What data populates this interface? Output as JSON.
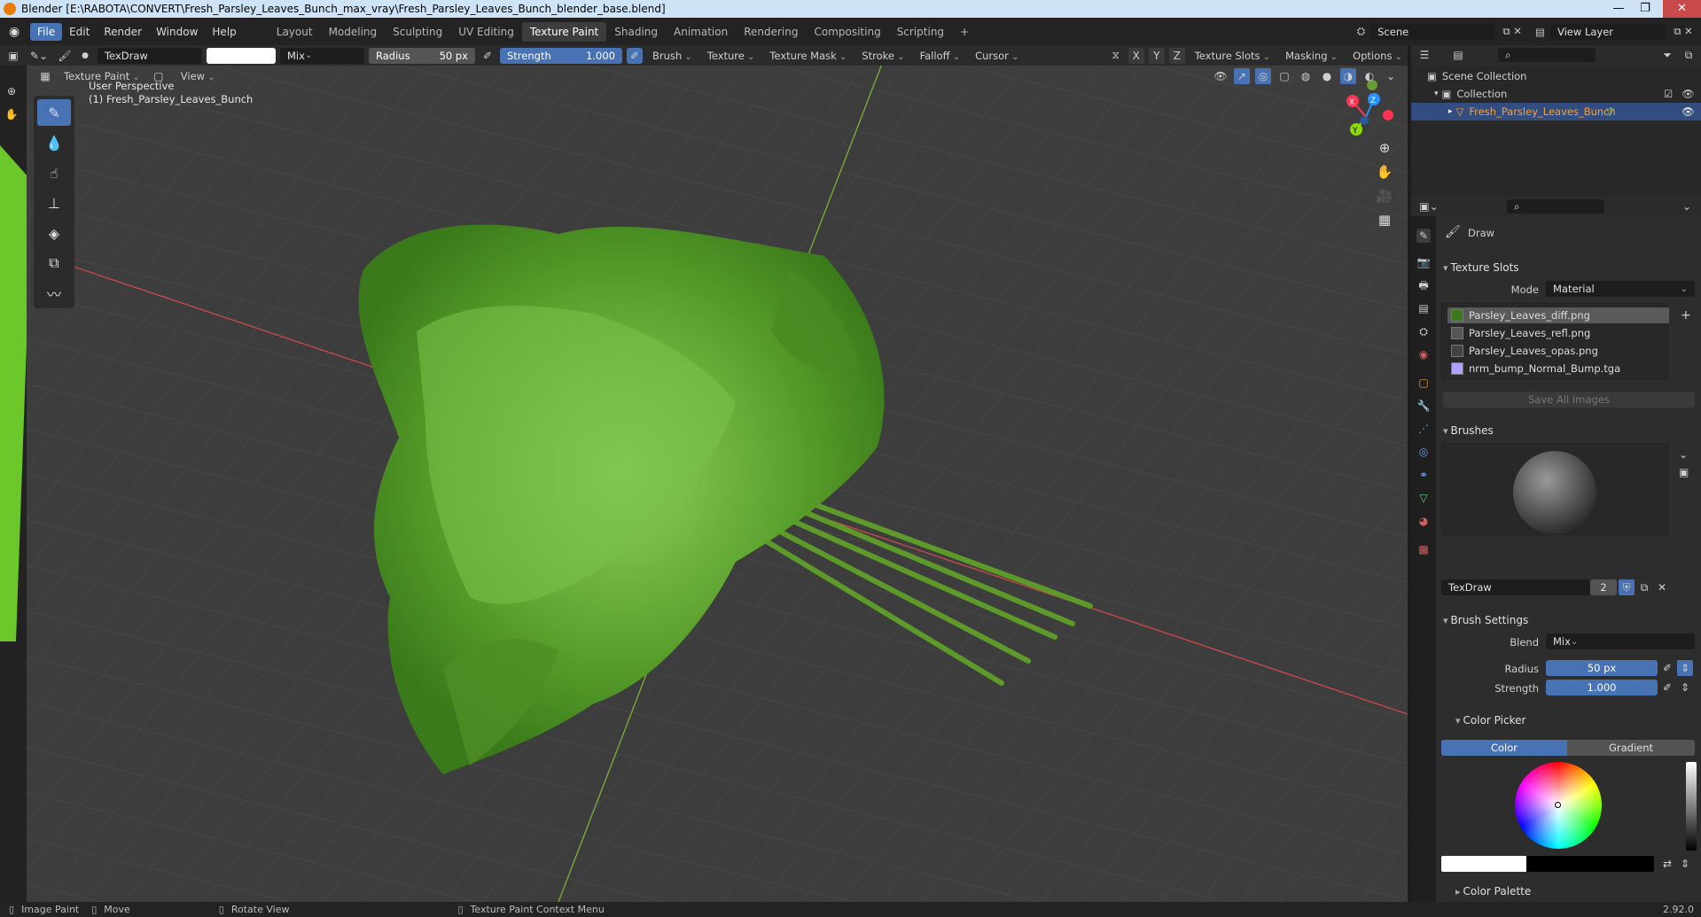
{
  "window": {
    "title": "Blender [E:\\RABOTA\\CONVERT\\Fresh_Parsley_Leaves_Bunch_max_vray\\Fresh_Parsley_Leaves_Bunch_blender_base.blend]",
    "minimize": "—",
    "maximize": "❐",
    "close": "✕"
  },
  "menus": [
    "File",
    "Edit",
    "Render",
    "Window",
    "Help"
  ],
  "workspaces": [
    "Layout",
    "Modeling",
    "Sculpting",
    "UV Editing",
    "Texture Paint",
    "Shading",
    "Animation",
    "Rendering",
    "Compositing",
    "Scripting"
  ],
  "workspace_add": "+",
  "scene": {
    "name": "Scene",
    "view_layer": "View Layer"
  },
  "tool_header": {
    "brush_name": "TexDraw",
    "blend": "Mix",
    "radius_label": "Radius",
    "radius_value": "50 px",
    "strength_label": "Strength",
    "strength_value": "1.000",
    "menus": [
      "Brush",
      "Texture",
      "Texture Mask",
      "Stroke",
      "Falloff",
      "Cursor"
    ],
    "axes": [
      "X",
      "Y",
      "Z"
    ],
    "right_menus": [
      "Texture Slots",
      "Masking",
      "Options"
    ]
  },
  "mode_header": {
    "mode": "Texture Paint",
    "view": "View"
  },
  "viewport": {
    "perspective": "User Perspective",
    "object": "(1) Fresh_Parsley_Leaves_Bunch",
    "gizmo_x": "X",
    "gizmo_y": "Y",
    "gizmo_z": "Z"
  },
  "outliner": {
    "scene_collection": "Scene Collection",
    "collection": "Collection",
    "object": "Fresh_Parsley_Leaves_Bunch"
  },
  "properties": {
    "tool": "Draw",
    "texture_slots": {
      "title": "Texture Slots",
      "mode_label": "Mode",
      "mode_value": "Material",
      "slots": [
        "Parsley_Leaves_diff.png",
        "Parsley_Leaves_refl.png",
        "Parsley_Leaves_opas.png",
        "nrm_bump_Normal_Bump.tga"
      ],
      "save_all": "Save All Images"
    },
    "brushes": {
      "title": "Brushes",
      "name": "TexDraw",
      "users": "2"
    },
    "brush_settings": {
      "title": "Brush Settings",
      "blend_label": "Blend",
      "blend_value": "Mix",
      "radius_label": "Radius",
      "radius_value": "50 px",
      "strength_label": "Strength",
      "strength_value": "1.000"
    },
    "color_picker": {
      "title": "Color Picker",
      "tab_color": "Color",
      "tab_gradient": "Gradient"
    },
    "color_palette": {
      "title": "Color Palette"
    }
  },
  "status": {
    "image_paint": "Image Paint",
    "move": "Move",
    "rotate": "Rotate View",
    "context_menu": "Texture Paint Context Menu",
    "version": "2.92.0"
  },
  "colors": {
    "accent": "#4772b3",
    "x_axis": "#ff3352",
    "y_axis": "#8bdc00",
    "z_axis": "#2890ff",
    "parsley": "#5aa02c"
  }
}
